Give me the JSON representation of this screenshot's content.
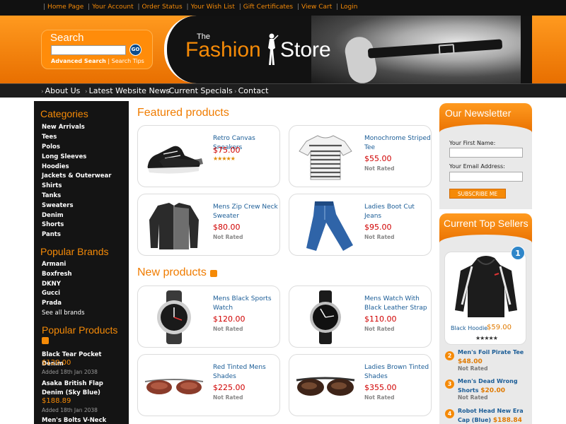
{
  "top_links": [
    "Home Page",
    "Your Account",
    "Order Status",
    "Your Wish List",
    "Gift Certificates",
    "View Cart",
    "Login"
  ],
  "logo": {
    "the": "The",
    "fashion": "Fashion",
    "store": "Store"
  },
  "search": {
    "title": "Search",
    "go": "GO",
    "advanced": "Advanced Search",
    "sep": "|",
    "tips": "Search Tips"
  },
  "nav": [
    "About Us",
    "Latest Website News",
    "Current Specials",
    "Contact"
  ],
  "categories": {
    "heading": "Categories",
    "items": [
      "New Arrivals",
      "Tees",
      "Polos",
      "Long Sleeves",
      "Hoodies",
      "Jackets & Outerwear",
      "Shirts",
      "Tanks",
      "Sweaters",
      "Denim",
      "Shorts",
      "Pants"
    ]
  },
  "brands": {
    "heading": "Popular Brands",
    "items": [
      "Armani",
      "Boxfresh",
      "DKNY",
      "Gucci",
      "Prada"
    ],
    "see_all": "See all brands"
  },
  "popular_products": {
    "heading": "Popular Products",
    "items": [
      {
        "name": "Black Tear Pocket Denim",
        "price": "$120.00",
        "date": "Added 18th Jan 2038"
      },
      {
        "name": "Asaka British Flap Denim (Sky Blue)",
        "price": "$188.89",
        "date": "Added 18th Jan 2038"
      },
      {
        "name": "Men's Bolts V-Neck",
        "price": "",
        "date": ""
      }
    ]
  },
  "featured": {
    "heading": "Featured products",
    "items": [
      {
        "name": "Retro Canvas Sneakers",
        "price": "$75.00",
        "rating": "★★★★★",
        "icon": "sneaker-icon"
      },
      {
        "name": "Monochrome Striped Tee",
        "price": "$55.00",
        "rating": "Not Rated",
        "icon": "tee-icon"
      },
      {
        "name": "Mens Zip Crew Neck Sweater",
        "price": "$80.00",
        "rating": "Not Rated",
        "icon": "sweater-icon"
      },
      {
        "name": "Ladies Boot Cut Jeans",
        "price": "$95.00",
        "rating": "Not Rated",
        "icon": "jeans-icon"
      }
    ]
  },
  "new_products": {
    "heading": "New products",
    "items": [
      {
        "name": "Mens Black Sports Watch",
        "price": "$120.00",
        "rating": "Not Rated",
        "icon": "sports-watch-icon"
      },
      {
        "name": "Mens Watch With Black Leather Strap",
        "price": "$110.00",
        "rating": "Not Rated",
        "icon": "leather-watch-icon"
      },
      {
        "name": "Red Tinted Mens Shades",
        "price": "$225.00",
        "rating": "Not Rated",
        "icon": "red-shades-icon"
      },
      {
        "name": "Ladies Brown Tinted Shades",
        "price": "$355.00",
        "rating": "Not Rated",
        "icon": "brown-shades-icon"
      }
    ]
  },
  "newsletter": {
    "heading": "Our Newsletter",
    "first_name_label": "Your First Name:",
    "email_label": "Your Email Address:",
    "button": "SUBSCRIBE ME"
  },
  "top_sellers": {
    "heading": "Current Top Sellers",
    "featured": {
      "rank": "1",
      "name": "Black Hoodie",
      "price": "$59.00",
      "rating": "★★★★★"
    },
    "items": [
      {
        "rank": "2",
        "name": "Men's Foil Pirate Tee",
        "price": "$48.00",
        "rating": "Not Rated"
      },
      {
        "rank": "3",
        "name": "Men's Dead Wrong Shorts",
        "price": "$20.00",
        "rating": "Not Rated"
      },
      {
        "rank": "4",
        "name": "Robot Head New Era Cap (Blue)",
        "price": "$188.84",
        "rating": ""
      }
    ]
  },
  "colors": {
    "accent": "#f58a07",
    "link": "#1a5c96",
    "price": "#d00000",
    "dark": "#141414"
  }
}
